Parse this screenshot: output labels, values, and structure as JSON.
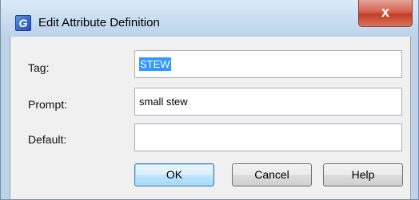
{
  "window": {
    "title": "Edit Attribute Definition",
    "icon_glyph": "G",
    "icon_name": "app-icon",
    "close_glyph": "x"
  },
  "fields": {
    "tag": {
      "label": "Tag:",
      "value": "STEW",
      "selected": true
    },
    "prompt": {
      "label": "Prompt:",
      "value": "small stew"
    },
    "default": {
      "label": "Default:",
      "value": ""
    }
  },
  "buttons": {
    "ok": "OK",
    "cancel": "Cancel",
    "help": "Help"
  },
  "colors": {
    "selection": "#3399ff",
    "close_button": "#c23d28"
  }
}
